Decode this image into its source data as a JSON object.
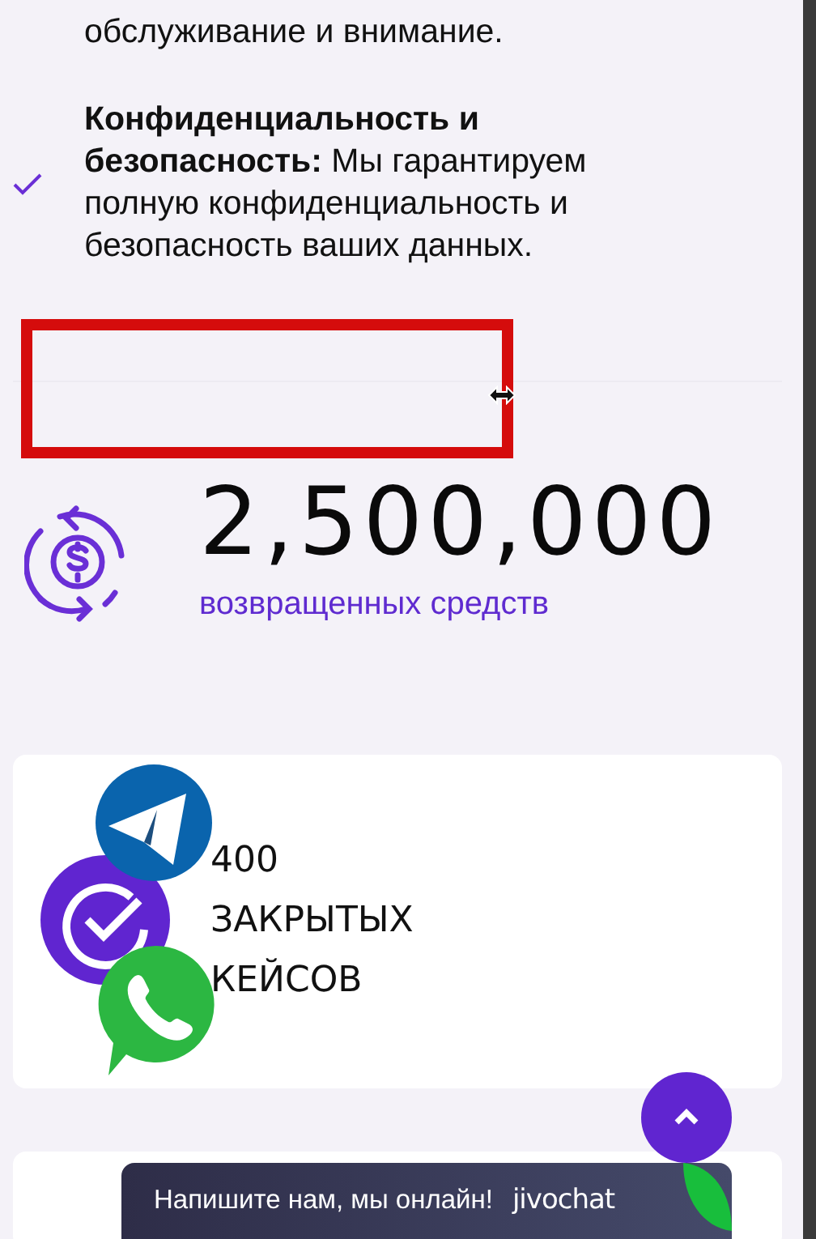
{
  "benefits": [
    {
      "text": "обслуживание и внимание.",
      "check": false
    },
    {
      "text": "**Конфиденциальность и безопасность:** Мы гарантируем полную конфиденциальность и безопасность ваших данных.",
      "check": true
    }
  ],
  "stat": {
    "amount": "2,500,000",
    "caption": "возвращенных средств"
  },
  "case_card": {
    "lines": [
      "400",
      "ЗАКРЫТЫХ",
      "КЕЙСОВ"
    ]
  },
  "chat": {
    "message": "Напишите нам, мы онлайн!",
    "brand": "jivochat"
  }
}
